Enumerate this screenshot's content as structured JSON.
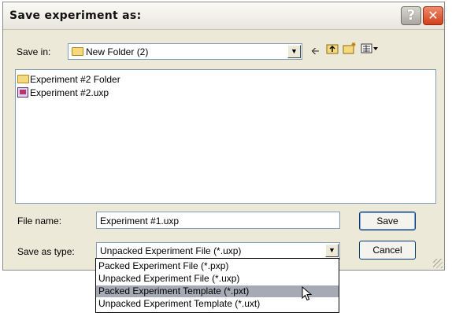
{
  "window": {
    "title": "Save experiment as:",
    "help_glyph": "?",
    "close_glyph": "✕"
  },
  "save_in": {
    "label": "Save in:",
    "value": "New Folder (2)"
  },
  "toolbar_icons": [
    "back-arrow-icon",
    "up-folder-icon",
    "new-folder-icon",
    "view-menu-icon"
  ],
  "files": [
    {
      "name": "Experiment #2 Folder",
      "icon": "folder-icon"
    },
    {
      "name": "Experiment #2.uxp",
      "icon": "experiment-file-icon"
    }
  ],
  "file_name": {
    "label": "File name:",
    "value": "Experiment #1.uxp"
  },
  "save_as_type": {
    "label": "Save as type:",
    "value": "Unpacked Experiment File (*.uxp)",
    "options": [
      "Packed Experiment File (*.pxp)",
      "Unpacked Experiment File (*.uxp)",
      "Packed Experiment Template (*.pxt)",
      "Unpacked Experiment Template (*.uxt)"
    ],
    "highlighted_option": "Packed Experiment Template (*.pxt)"
  },
  "buttons": {
    "save": "Save",
    "cancel": "Cancel"
  },
  "colors": {
    "highlight": "#a6aab4",
    "close_red": "#d2401c",
    "dialog_bg": "#ece9d8"
  }
}
